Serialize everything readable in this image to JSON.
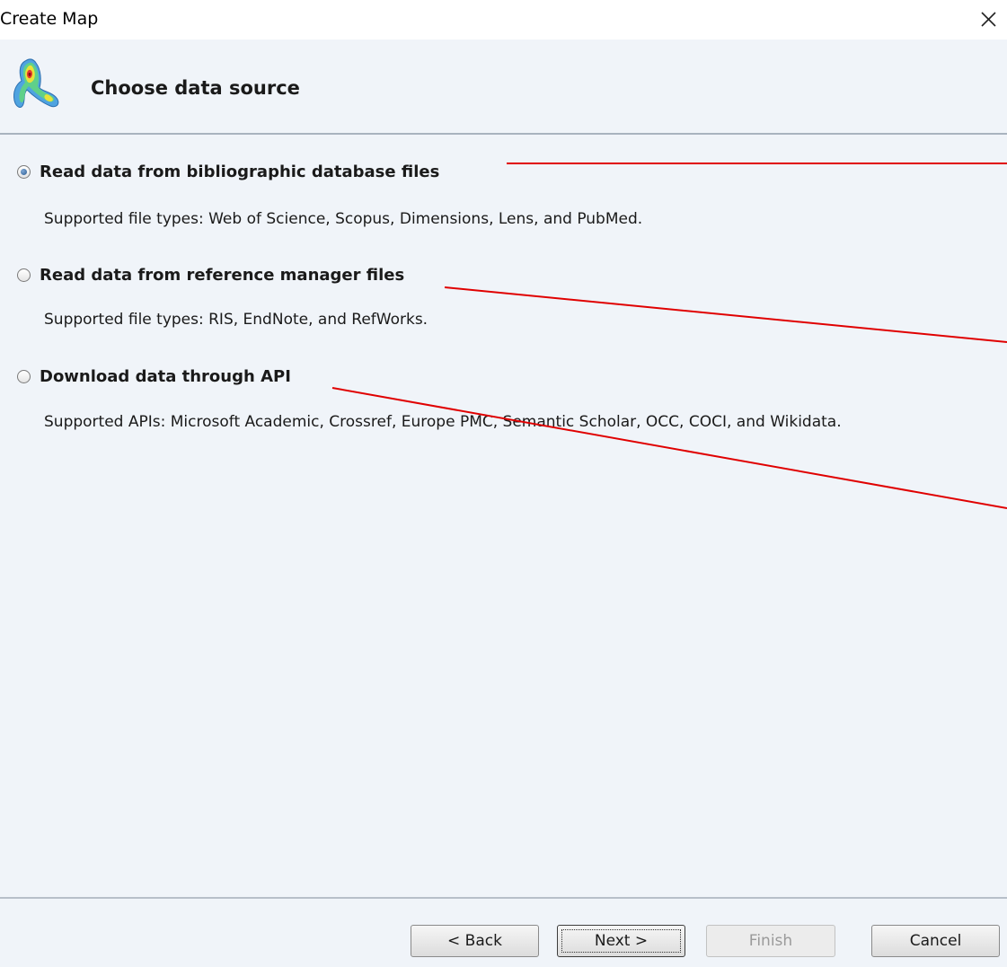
{
  "window": {
    "title": "Create Map",
    "close_icon": "close-icon"
  },
  "header": {
    "icon": "vosviewer-density-logo",
    "title": "Choose data source"
  },
  "options": [
    {
      "label": "Read data from bibliographic database files",
      "description": "Supported file types: Web of Science, Scopus, Dimensions, Lens, and PubMed.",
      "selected": true
    },
    {
      "label": "Read data from reference manager files",
      "description": "Supported file types: RIS, EndNote, and RefWorks.",
      "selected": false
    },
    {
      "label": "Download data through API",
      "description": "Supported APIs: Microsoft Academic, Crossref, Europe PMC, Semantic Scholar, OCC, COCI, and Wikidata.",
      "selected": false
    }
  ],
  "buttons": {
    "back": "< Back",
    "next": "Next >",
    "finish": "Finish",
    "cancel": "Cancel"
  },
  "colors": {
    "panel_background": "#f0f4f9",
    "annotation_line": "#e00000",
    "radio_selected": "#2c5c91"
  }
}
